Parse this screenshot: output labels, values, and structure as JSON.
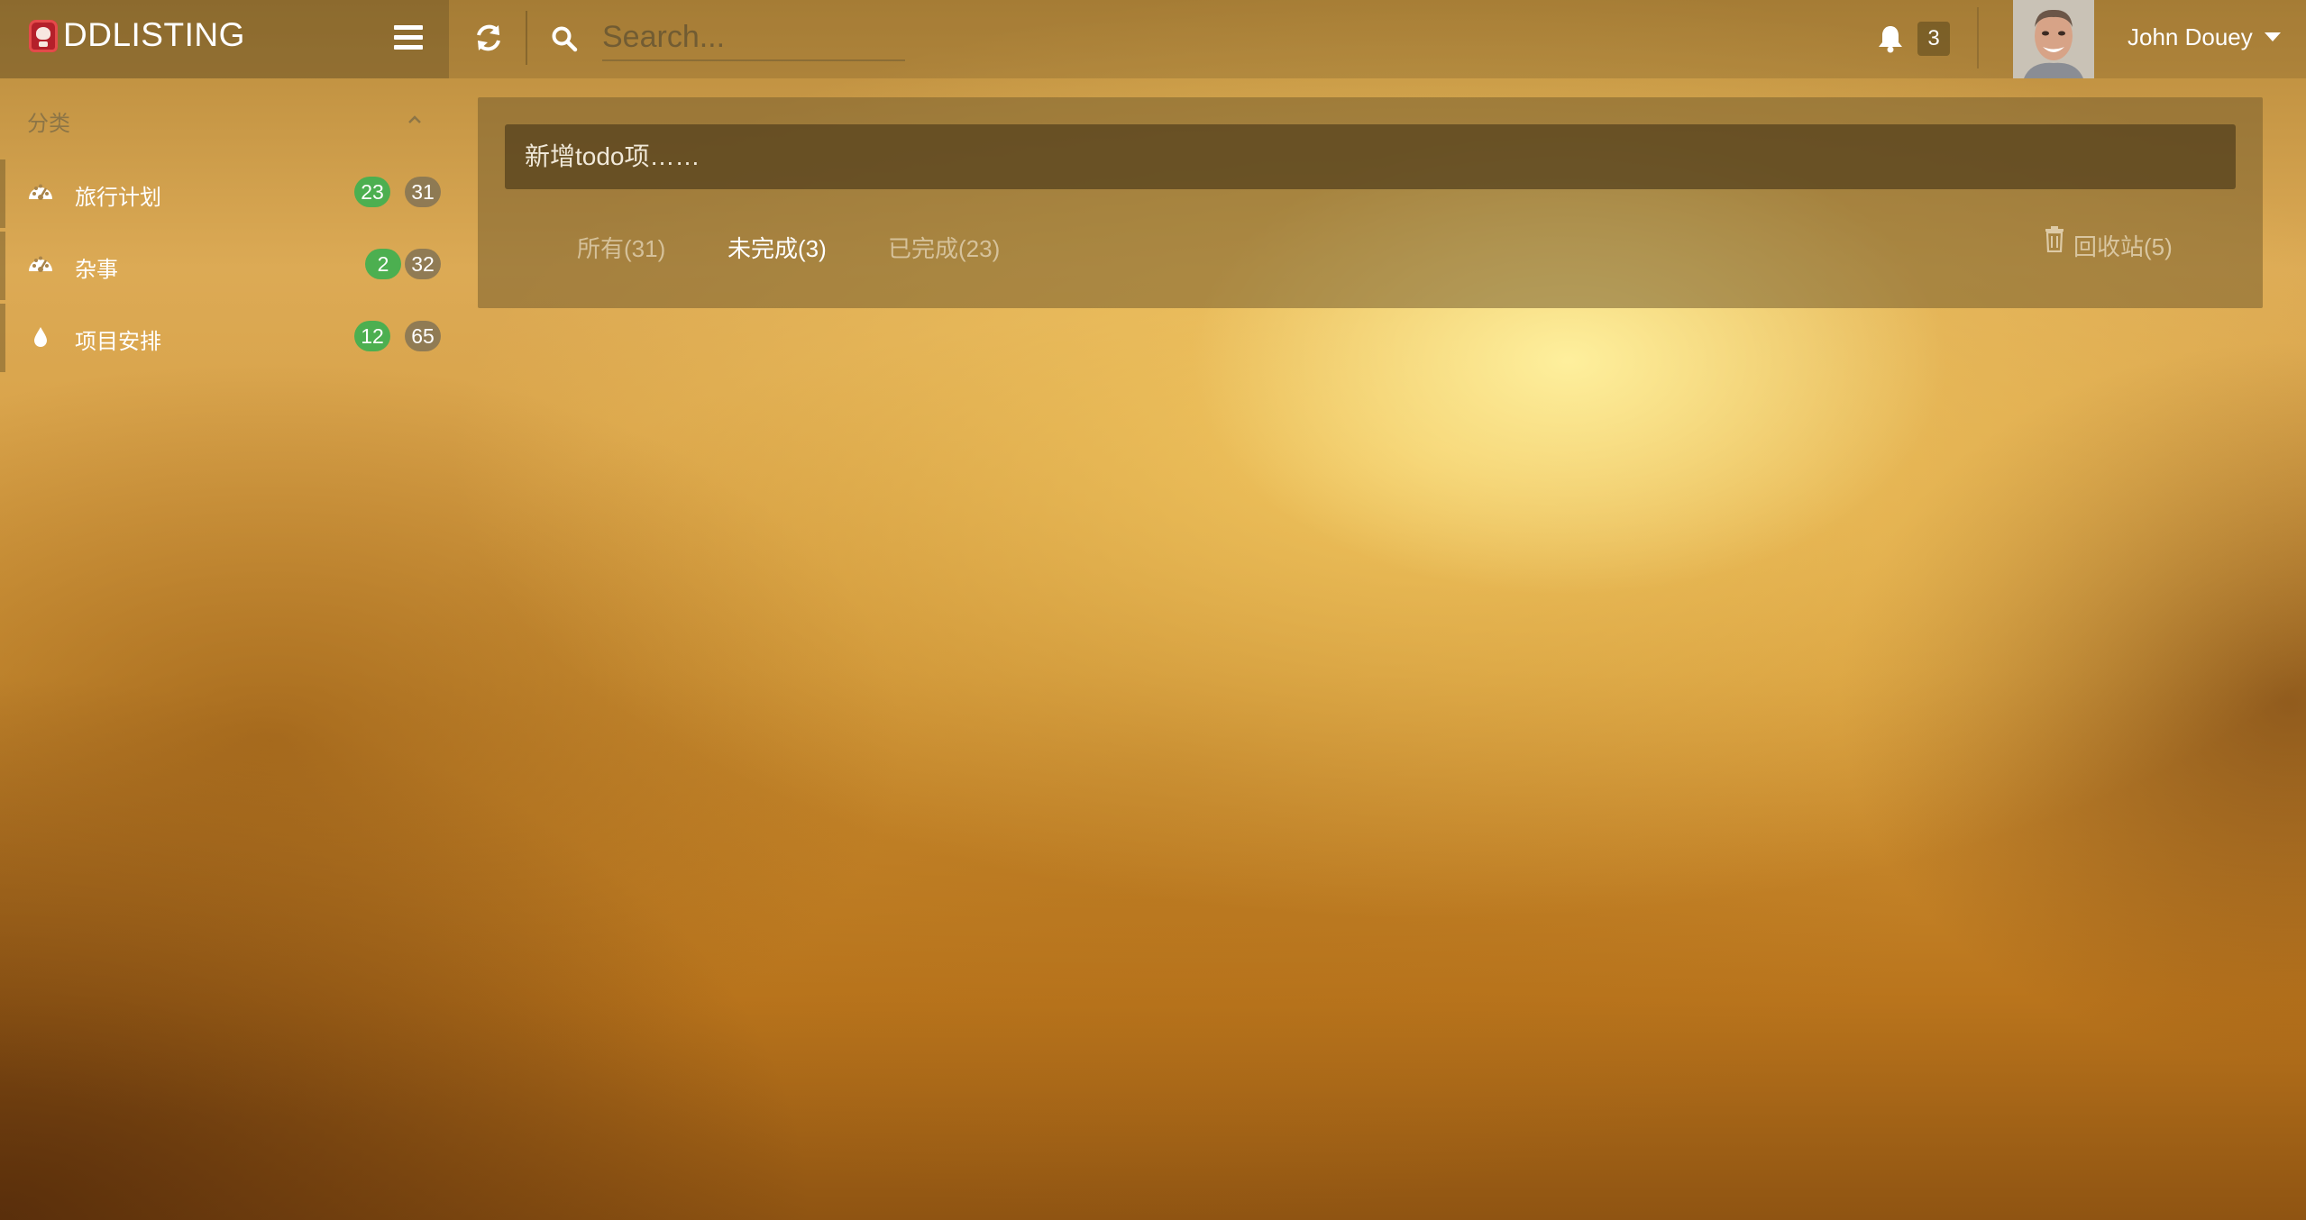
{
  "header": {
    "brand": "DDLISTING",
    "search_placeholder": "Search...",
    "notifications_count": "3",
    "user_name": "John Douey"
  },
  "sidebar": {
    "heading": "分类",
    "items": [
      {
        "label": "旅行计划",
        "icon": "dashboard-icon",
        "badge_done": "23",
        "badge_total": "31"
      },
      {
        "label": "杂事",
        "icon": "dashboard-icon",
        "badge_done": "2",
        "badge_total": "32"
      },
      {
        "label": "项目安排",
        "icon": "tint-icon",
        "badge_done": "12",
        "badge_total": "65"
      }
    ]
  },
  "main": {
    "todo_placeholder": "新增todo项……",
    "filters": [
      {
        "label": "所有(31)",
        "active": false
      },
      {
        "label": "未完成(3)",
        "active": true
      },
      {
        "label": "已完成(23)",
        "active": false
      }
    ],
    "trash_label": "回收站(5)"
  },
  "colors": {
    "badge_green": "#4caf50",
    "badge_grey": "#827355",
    "brand_red": "#b4202a"
  }
}
